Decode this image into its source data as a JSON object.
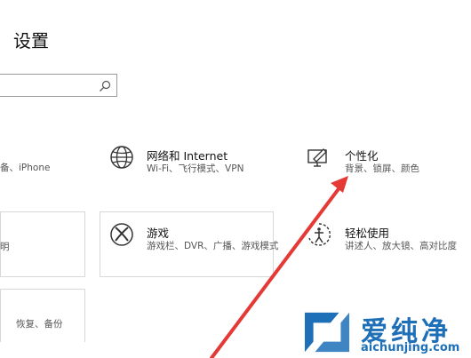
{
  "window": {
    "title": "设置"
  },
  "search": {
    "value": "",
    "placeholder": "",
    "icon": "search-icon"
  },
  "tiles": [
    {
      "title": "",
      "subtitle": "备、iPhone"
    },
    {
      "title": "网络和 Internet",
      "subtitle": "Wi-Fi、飞行模式、VPN",
      "icon": "globe-icon"
    },
    {
      "title": "个性化",
      "subtitle": "背景、锁屏、颜色",
      "icon": "personalize-icon"
    },
    {
      "title": "",
      "subtitle": "明"
    },
    {
      "title": "游戏",
      "subtitle": "游戏栏、DVR、广播、游戏模式",
      "icon": "xbox-icon"
    },
    {
      "title": "轻松使用",
      "subtitle": "讲述人、放大镜、高对比度",
      "icon": "ease-of-access-icon"
    },
    {
      "title": "",
      "subtitle": "恢复、备份"
    }
  ],
  "watermark": {
    "name": "爱纯净",
    "url": "aichunjing.com"
  },
  "colors": {
    "arrow": "#e53935",
    "watermark": "#1d6fb8"
  }
}
